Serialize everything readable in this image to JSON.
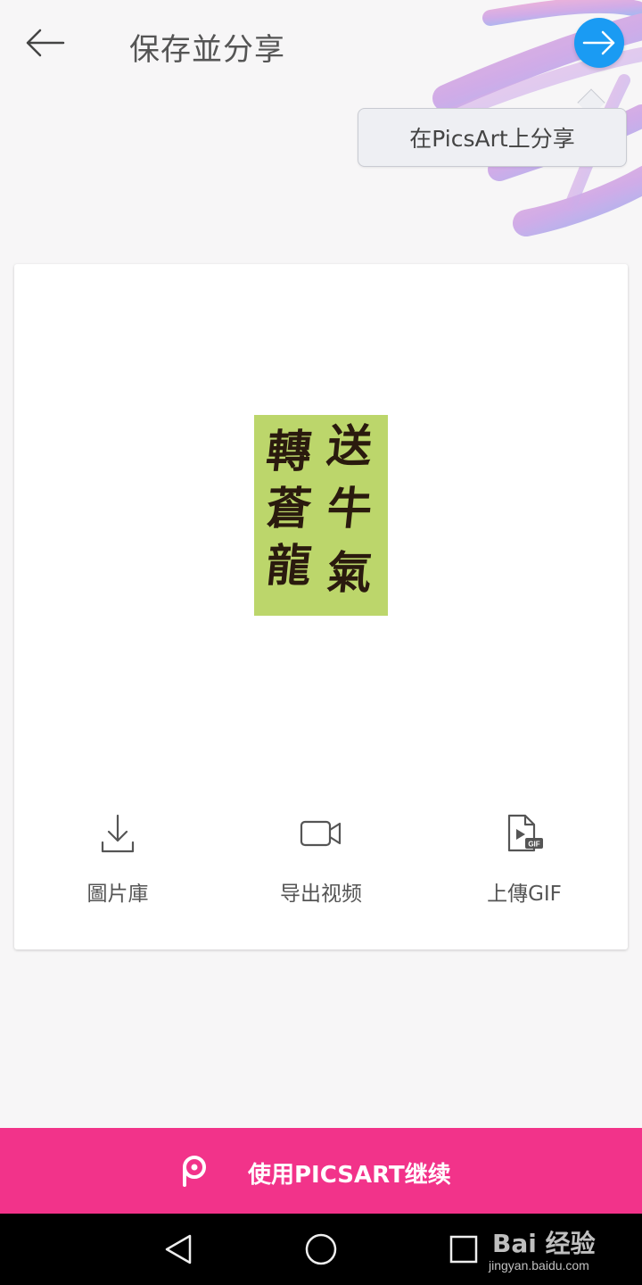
{
  "header": {
    "title": "保存並分享",
    "back_icon": "arrow-left-icon",
    "next_icon": "arrow-right-icon",
    "next_color": "#1a9bf3"
  },
  "tooltip": {
    "text": "在PicsArt上分享"
  },
  "preview": {
    "background": "#bcd66b",
    "calligraphy_right": [
      "送",
      "牛",
      "氣"
    ],
    "calligraphy_left": [
      "轉",
      "蒼",
      "龍"
    ]
  },
  "actions": [
    {
      "label": "圖片庫",
      "icon": "download-icon"
    },
    {
      "label": "导出视频",
      "icon": "video-camera-icon"
    },
    {
      "label": "上傳GIF",
      "icon": "gif-file-icon"
    }
  ],
  "cta": {
    "label": "使用PICSART继续",
    "icon": "picsart-logo-icon",
    "color": "#f2338a"
  },
  "system_nav": {
    "back_icon": "triangle-back-icon",
    "home_icon": "circle-home-icon",
    "recents_icon": "square-recents-icon"
  },
  "watermark": {
    "main": "Bai 经验",
    "sub": "jingyan.baidu.com"
  }
}
